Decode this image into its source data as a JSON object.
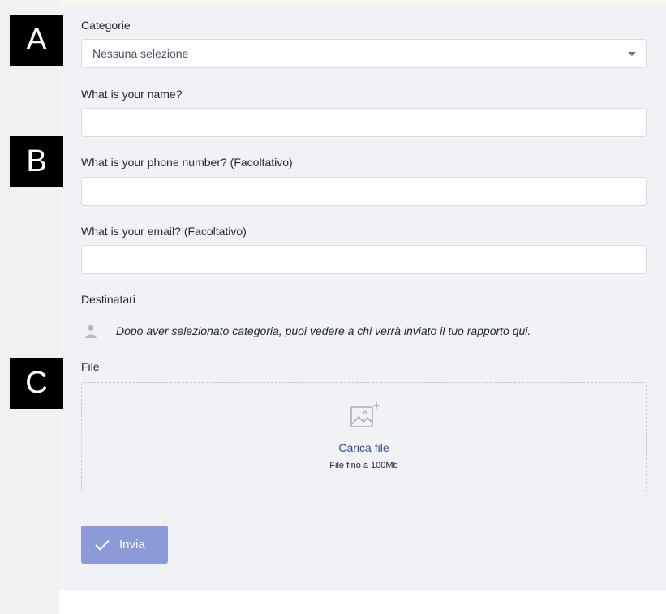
{
  "markers": [
    "A",
    "B",
    "C"
  ],
  "form": {
    "category": {
      "label": "Categorie",
      "selected": "Nessuna selezione"
    },
    "name": {
      "label": "What is your name?",
      "value": ""
    },
    "phone": {
      "label": "What is your phone number? (Facoltativo)",
      "value": ""
    },
    "email": {
      "label": "What is your email? (Facoltativo)",
      "value": ""
    },
    "recipients": {
      "label": "Destinatari",
      "hint": "Dopo aver selezionato categoria, puoi vedere a chi verrà inviato il tuo rapporto qui.",
      "icon": "person-icon"
    },
    "file": {
      "label": "File",
      "upload_title": "Carica file",
      "upload_limit": "File fino a 100Mb",
      "icon": "image-add-icon"
    },
    "submit": {
      "label": "Invia",
      "icon": "checkmark-icon",
      "color": "#8c9ad8"
    }
  }
}
